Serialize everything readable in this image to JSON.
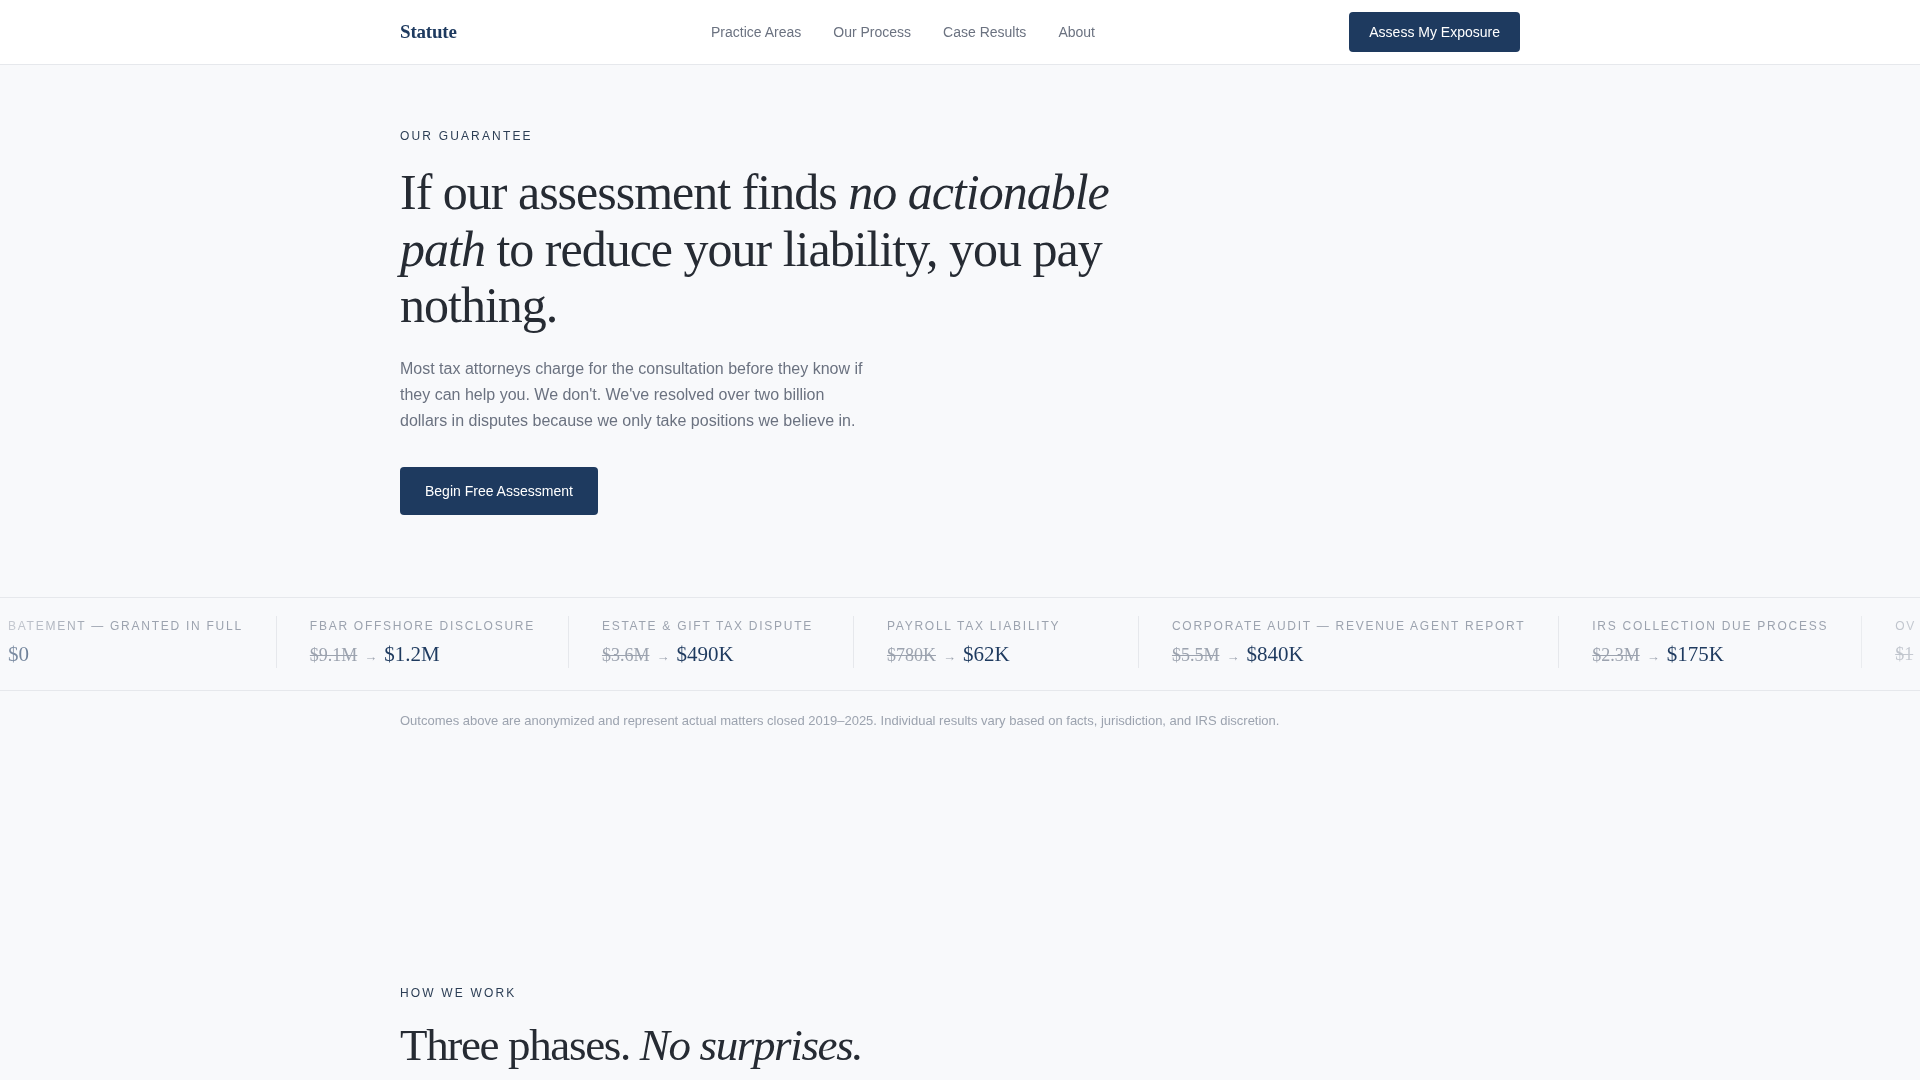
{
  "nav": {
    "logo": "Statute",
    "links": [
      "Practice Areas",
      "Our Process",
      "Case Results",
      "About"
    ],
    "cta": "Assess My Exposure"
  },
  "hero": {
    "eyebrow": "OUR GUARANTEE",
    "headline": "If our assessment finds *no actionable path* to reduce your liability, you pay nothing.",
    "body": "Most tax attorneys charge for the consultation before they know if they can help you. We don't. We've resolved over two billion dollars in disputes because we only take positions we believe in.",
    "cta": "Begin Free Assessment"
  },
  "results": {
    "items": [
      {
        "label": "BATEMENT — GRANTED IN FULL",
        "after": "$0"
      },
      {
        "label": "FBAR OFFSHORE DISCLOSURE",
        "before": "$9.1M",
        "arrow": "→",
        "after": "$1.2M"
      },
      {
        "label": "ESTATE & GIFT TAX DISPUTE",
        "before": "$3.6M",
        "arrow": "→",
        "after": "$490K"
      },
      {
        "label": "PAYROLL TAX LIABILITY",
        "before": "$780K",
        "arrow": "→",
        "after": "$62K"
      },
      {
        "label": "CORPORATE AUDIT — REVENUE AGENT REPORT",
        "before": "$5.5M",
        "arrow": "→",
        "after": "$840K"
      },
      {
        "label": "IRS COLLECTION DUE PROCESS",
        "before": "$2.3M",
        "arrow": "→",
        "after": "$175K"
      },
      {
        "label": "OV",
        "before": "$1"
      }
    ],
    "note": "Outcomes above are anonymized and represent actual matters closed 2019–2025. Individual results vary based on facts, jurisdiction, and IRS discretion."
  },
  "process": {
    "eyebrow": "HOW WE WORK",
    "headline": "Three phases. *No surprises.*"
  }
}
